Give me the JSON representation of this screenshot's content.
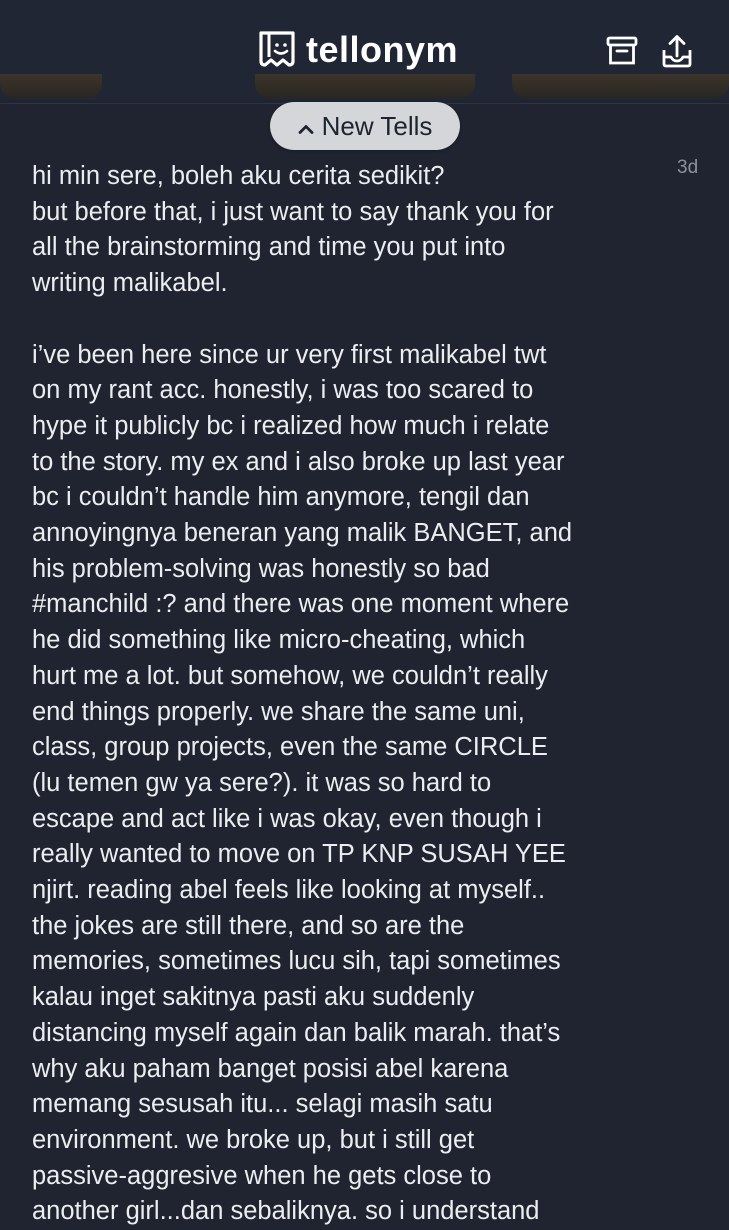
{
  "header": {
    "app_name": "tellonym",
    "logo_icon": "tellonym-logo-icon",
    "archive_icon": "archive-box-icon",
    "share_icon": "share-upload-icon"
  },
  "new_tells": {
    "label": "New Tells",
    "icon": "chevron-up-icon"
  },
  "tell": {
    "time": "3d",
    "paragraph1": [
      "hi min sere, boleh aku cerita sedikit?",
      "but before that, i just want to say thank you for",
      "all the brainstorming and time you put into",
      "writing malikabel."
    ],
    "paragraph2": [
      "i’ve been here since ur very first malikabel twt",
      "on my rant acc. honestly, i was too scared to",
      "hype it publicly bc i realized how much i relate",
      "to the story. my ex and i also broke up last year",
      "bc i couldn’t handle him anymore, tengil dan",
      "annoyingnya beneran yang malik BANGET, and",
      "his problem-solving was honestly so bad",
      "#manchild :? and there was one moment where",
      "he did something like micro-cheating, which",
      "hurt me a lot. but somehow, we couldn’t really",
      "end things properly. we share the same uni,",
      "class, group projects, even the same CIRCLE",
      "(lu temen gw ya sere?). it was so hard to",
      "escape and act like i was okay, even though i",
      "really wanted to move on TP KNP SUSAH YEE",
      "njirt. reading abel feels like looking at myself..",
      "the jokes are still there, and so are the",
      "memories, sometimes lucu sih, tapi sometimes",
      "kalau inget sakitnya pasti aku suddenly",
      "distancing myself again dan balik marah. that’s",
      "why aku paham banget posisi abel karena",
      "memang sesusah itu... selagi masih satu",
      "environment. we broke up, but i still get",
      "passive-aggresive when he gets close to",
      "another girl...dan sebaliknya. so i understand"
    ]
  },
  "colors": {
    "background": "#1f2430",
    "text": "#ebedf0",
    "pill": "#d5d6d9",
    "muted": "#8b919c"
  }
}
